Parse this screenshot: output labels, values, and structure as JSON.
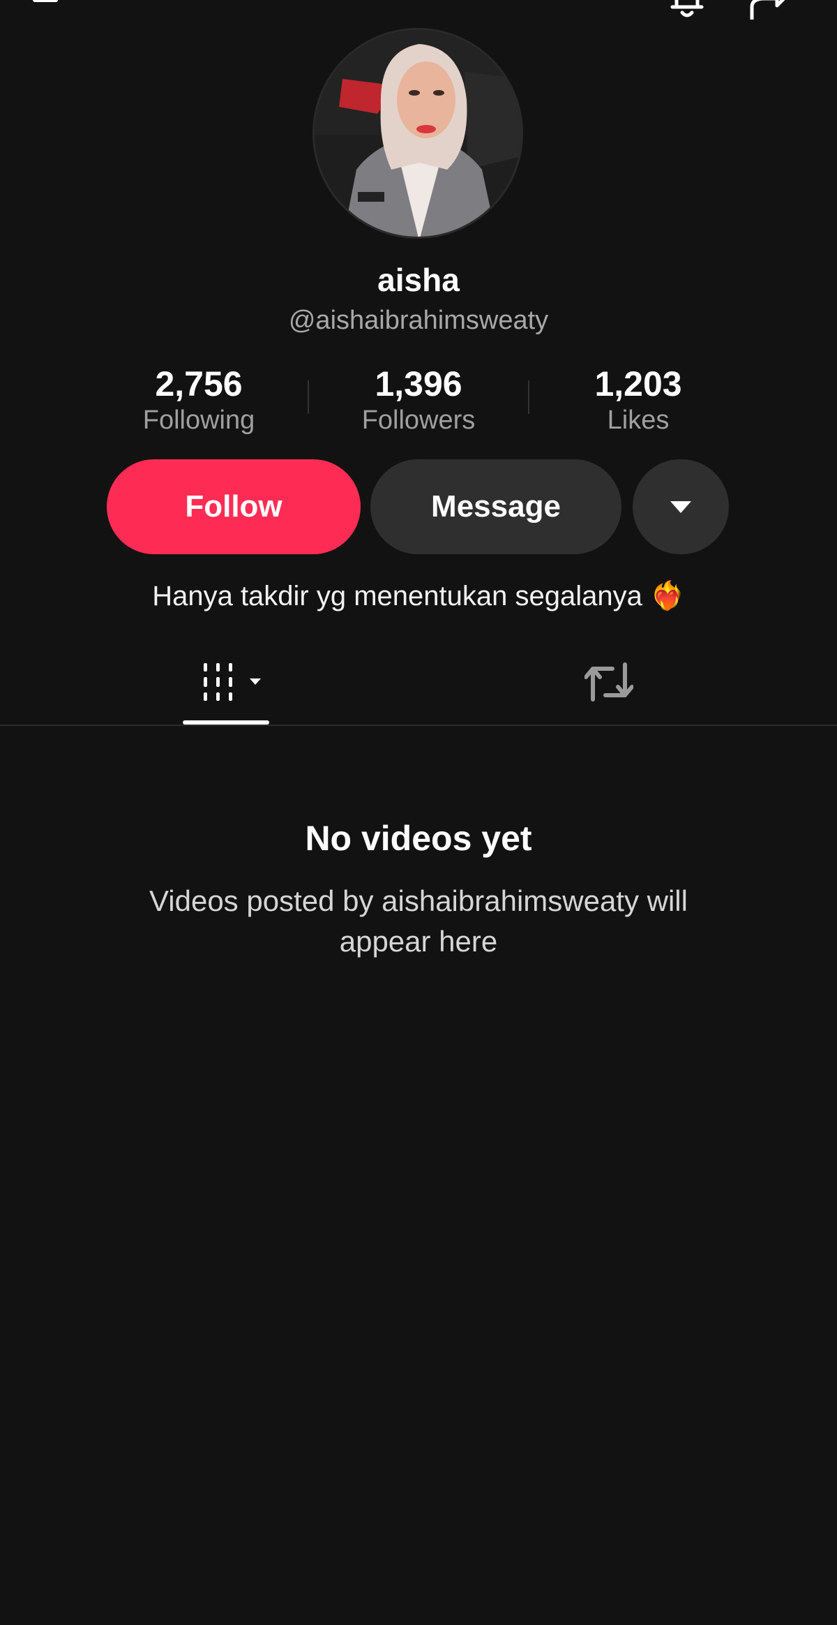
{
  "header": {
    "back_icon": "back-arrow-icon",
    "notification_icon": "bell-icon",
    "share_icon": "share-icon"
  },
  "profile": {
    "avatar_icon": "profile-photo",
    "display_name": "aisha",
    "username": "@aishaibrahimsweaty",
    "bio": "Hanya takdir yg menentukan segalanya ❤️‍🔥"
  },
  "stats": [
    {
      "value": "2,756",
      "label": "Following"
    },
    {
      "value": "1,396",
      "label": "Followers"
    },
    {
      "value": "1,203",
      "label": "Likes"
    }
  ],
  "actions": {
    "follow_label": "Follow",
    "message_label": "Message",
    "more_icon": "caret-down-icon"
  },
  "tabs": [
    {
      "name": "videos",
      "icon": "grid-filter-icon",
      "active": true
    },
    {
      "name": "reposts",
      "icon": "repost-icon",
      "active": false
    }
  ],
  "empty_state": {
    "title": "No videos yet",
    "subtitle": "Videos posted by aishaibrahimsweaty will appear here"
  },
  "colors": {
    "background": "#121212",
    "follow_button": "#fe2c55",
    "secondary_button": "#2f2f2f",
    "muted_text": "#a0a0a0"
  }
}
